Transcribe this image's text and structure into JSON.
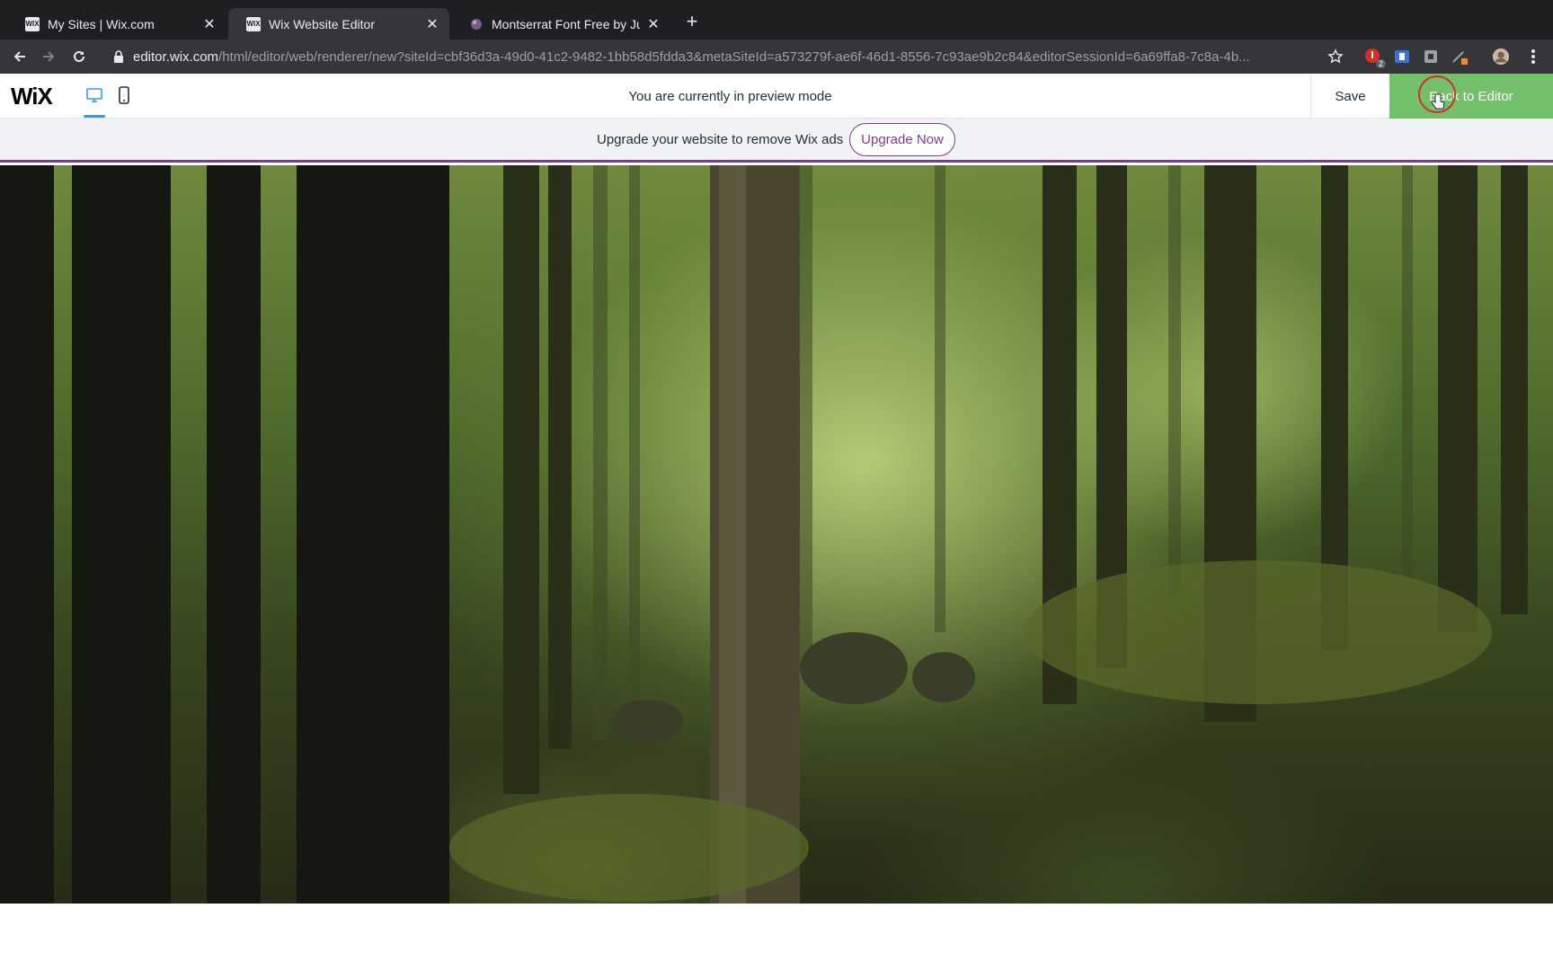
{
  "browser": {
    "tabs": [
      {
        "title": "My Sites | Wix.com",
        "active": false
      },
      {
        "title": "Wix Website Editor",
        "active": true
      },
      {
        "title": "Montserrat Font Free by Juliet",
        "active": false
      }
    ],
    "url_host": "editor.wix.com",
    "url_path": "/html/editor/web/renderer/new?siteId=cbf36d3a-49d0-41c2-9482-1bb58d5fdda3&metaSiteId=a573279f-ae6f-46d1-8556-7c93ae9b2c84&editorSessionId=6a69ffa8-7c8a-4b...",
    "extension_badge_count": "2"
  },
  "wix_header": {
    "logo": "WiX",
    "preview_message": "You are currently in preview mode",
    "save_label": "Save",
    "back_label": "Back to Editor",
    "active_device": "desktop"
  },
  "upgrade_banner": {
    "text": "Upgrade your website to remove Wix ads",
    "button_label": "Upgrade Now"
  },
  "hero": {
    "description_icon": "forest-background-image"
  },
  "colors": {
    "accent_green": "#74c06a",
    "upgrade_purple": "#7b3e8a",
    "device_blue": "#3899ec"
  }
}
